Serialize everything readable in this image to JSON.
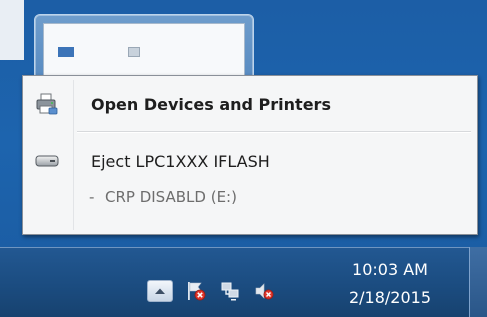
{
  "menu": {
    "open_devices_label": "Open Devices and Printers",
    "eject_label": "Eject LPC1XXX IFLASH",
    "sub_dash": "-",
    "sub_label": "CRP DISABLD (E:)"
  },
  "tray": {
    "icons": [
      "show-hidden-icons-arrow",
      "action-center-flag-icon",
      "network-icon",
      "volume-muted-icon"
    ]
  },
  "clock": {
    "time": "10:03 AM",
    "date": "2/18/2015"
  },
  "colors": {
    "desktop": "#1c5ea6",
    "taskbar": "#1b4c80",
    "menu_bg": "#f5f6f7",
    "error_red": "#e0352b"
  }
}
